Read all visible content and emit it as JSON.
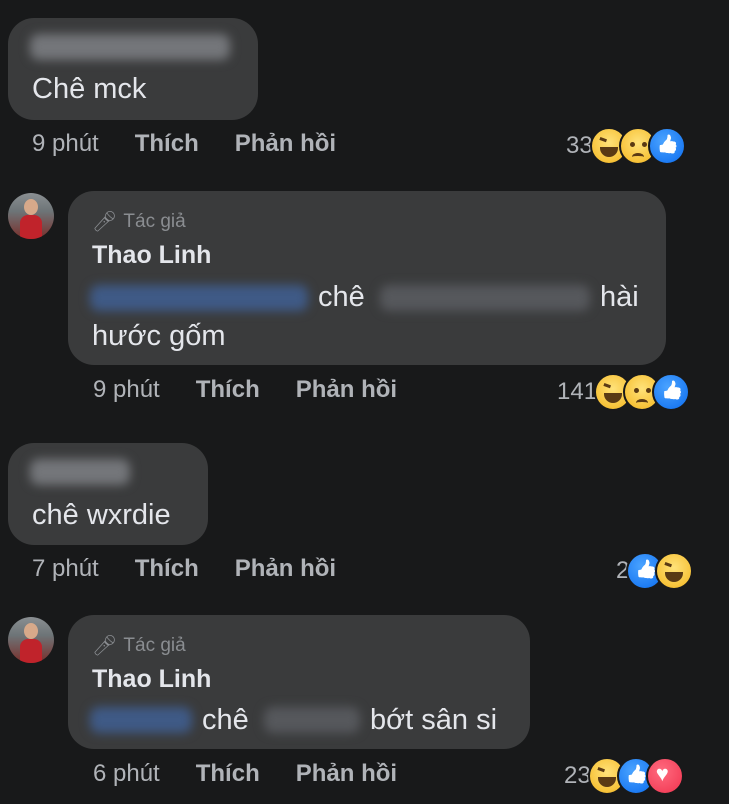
{
  "comments": [
    {
      "text": "Chê mck",
      "time": "9 phút",
      "like_label": "Thích",
      "reply_label": "Phản hồi",
      "reaction_count": "33",
      "reactions": [
        "haha-icon",
        "sad-icon",
        "like-icon"
      ]
    },
    {
      "author_badge": "Tác giả",
      "author_name": "Thao Linh",
      "text_parts": [
        "chê",
        "hài",
        "hước gốm"
      ],
      "time": "9 phút",
      "like_label": "Thích",
      "reply_label": "Phản hồi",
      "reaction_count": "141",
      "reactions": [
        "haha-icon",
        "sad-icon",
        "like-icon"
      ]
    },
    {
      "text": "chê wxrdie",
      "time": "7 phút",
      "like_label": "Thích",
      "reply_label": "Phản hồi",
      "reaction_count": "2",
      "reactions": [
        "like-icon",
        "haha-icon"
      ]
    },
    {
      "author_badge": "Tác giả",
      "author_name": "Thao Linh",
      "text_parts": [
        "chê",
        "bớt sân si"
      ],
      "time": "6 phút",
      "like_label": "Thích",
      "reply_label": "Phản hồi",
      "reaction_count": "23",
      "reactions": [
        "haha-icon",
        "like-icon",
        "love-icon"
      ]
    }
  ],
  "colors": {
    "background": "#18191a",
    "bubble": "#3a3b3c",
    "text": "#e4e6eb",
    "muted": "#b0b3b8",
    "like_blue": "#1877f2",
    "love_red": "#f33e58"
  }
}
